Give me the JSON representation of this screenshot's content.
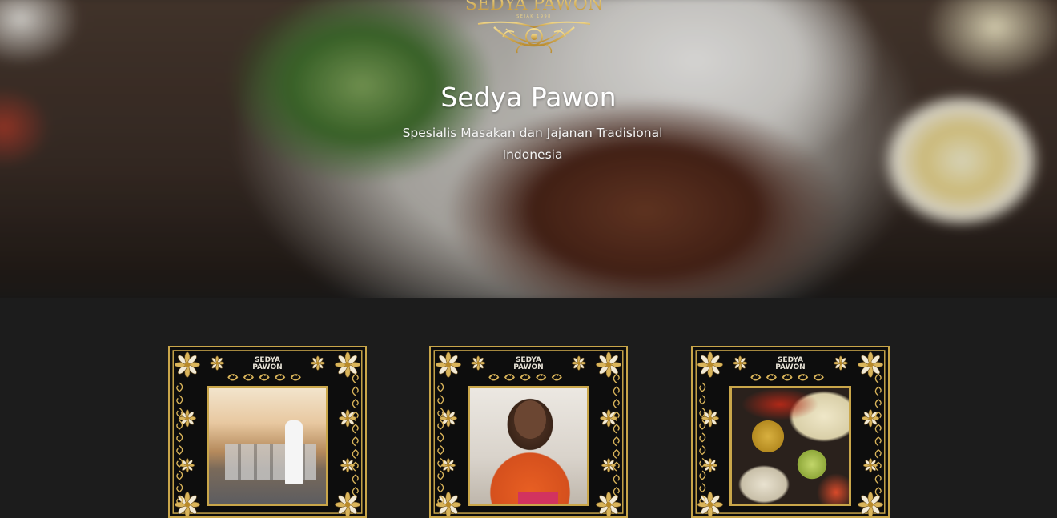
{
  "hero": {
    "logo_alt": "Sedya Pawon logo",
    "logo_text": "SEDYA PAWON",
    "logo_subtext": "SEJAK 1998",
    "title": "Sedya Pawon",
    "tagline": "Spesialis Masakan dan Jajanan Tradisional Indonesia"
  },
  "cards": [
    {
      "brand": "SEDYA\nPAWON",
      "photo_desc": "catering-buffet-photo"
    },
    {
      "brand": "SEDYA\nPAWON",
      "photo_desc": "chef-thumbs-up-photo"
    },
    {
      "brand": "SEDYA\nPAWON",
      "photo_desc": "spices-ingredients-photo"
    }
  ],
  "colors": {
    "background": "#1c1c1c",
    "gold": "#c9a64a",
    "title": "#ffffff"
  }
}
